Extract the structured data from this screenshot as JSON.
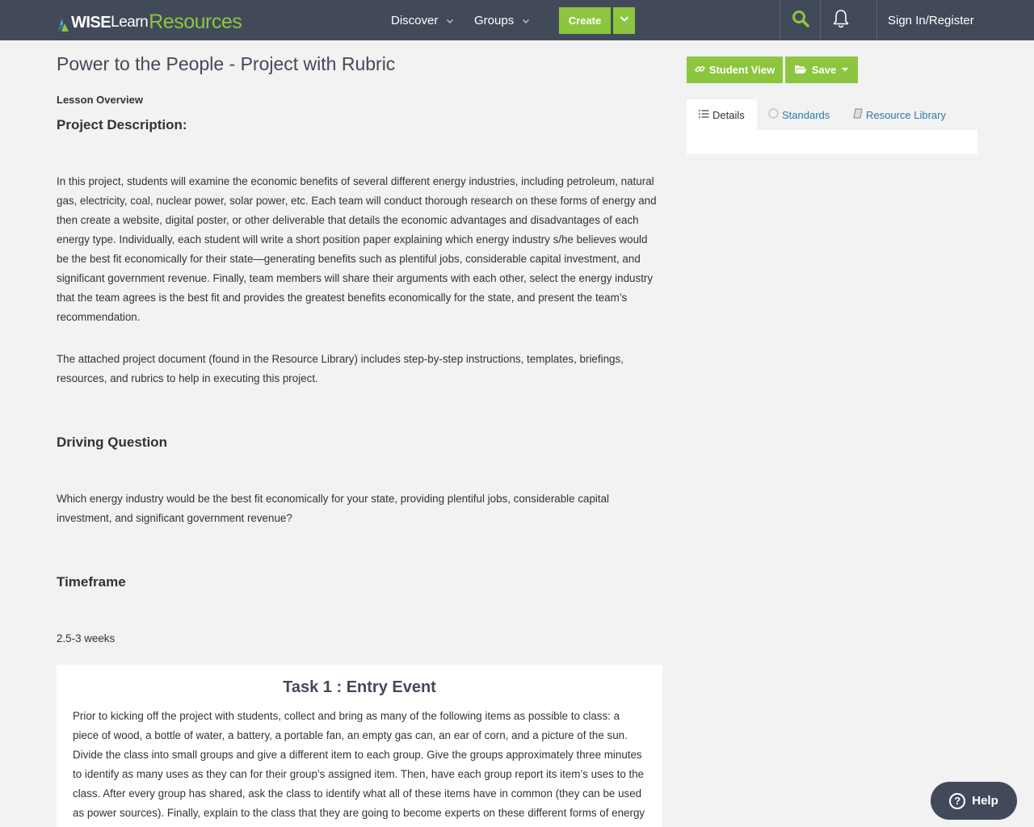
{
  "nav": {
    "logo_wise": "WISE",
    "logo_learn": "Learn",
    "logo_resources": "Resources",
    "discover_label": "Discover",
    "groups_label": "Groups",
    "create_label": "Create",
    "signin_label": "Sign In/Register"
  },
  "page": {
    "title": "Power to the People - Project with Rubric",
    "overview_label": "Lesson Overview"
  },
  "sections": {
    "project_heading": "Project Description:",
    "project_p1": "In this project, students will examine the economic benefits of several different energy industries, including petroleum, natural gas, electricity, coal, nuclear power, solar power, etc. Each team will conduct thorough research on these forms of energy and then create a website, digital poster, or other deliverable that details the economic advantages and disadvantages of each energy type. Individually, each student will write a short position paper explaining which energy industry s/he believes would be the best fit economically for their state—generating benefits such as plentiful jobs, considerable capital investment, and significant government revenue. Finally, team members will share their arguments with each other, select the energy industry that the team agrees is the best fit and provides the greatest benefits economically for the state, and present the team’s recommendation.",
    "project_p2": "The attached project document (found in the Resource Library) includes step-by-step instructions, templates, briefings, resources, and rubrics to help in executing this project.",
    "driving_heading": "Driving Question",
    "driving_text": "Which energy industry would be the best fit economically for your state, providing plentiful jobs, considerable capital investment, and significant government revenue?",
    "timeframe_heading": "Timeframe",
    "timeframe_text": "2.5-3 weeks"
  },
  "task": {
    "title": "Task 1 : Entry Event",
    "text": "Prior to kicking off the project with students, collect and bring as many of the following items as possible to class: a piece of wood, a bottle of water, a battery, a portable fan, an empty gas can, an ear of corn, and a picture of the sun. Divide the class into small groups and give a different item to each group. Give the groups approximately three minutes to identify as many uses as they can for their group’s assigned item. Then, have each group report its item’s uses to the class. After every group has shared, ask the class to identify what all of these items have in common (they can be used as power sources). Finally, explain to the class that they are going to become experts on these different forms of energy to determine which"
  },
  "sidebar": {
    "student_view_label": "Student View",
    "save_label": "Save",
    "tabs": [
      {
        "label": "Details"
      },
      {
        "label": "Standards"
      },
      {
        "label": "Resource Library"
      }
    ]
  },
  "help": {
    "label": "Help"
  },
  "colors": {
    "nav_bg": "#424a5a",
    "accent_green": "#8cc63f",
    "link_blue": "#2a7ab0",
    "page_bg": "#f1f2f1"
  },
  "icons": [
    "search-icon",
    "bell-icon",
    "chevron-down-icon",
    "link-icon",
    "folder-open-icon",
    "list-icon",
    "circle-icon",
    "book-icon",
    "question-circle-icon"
  ]
}
